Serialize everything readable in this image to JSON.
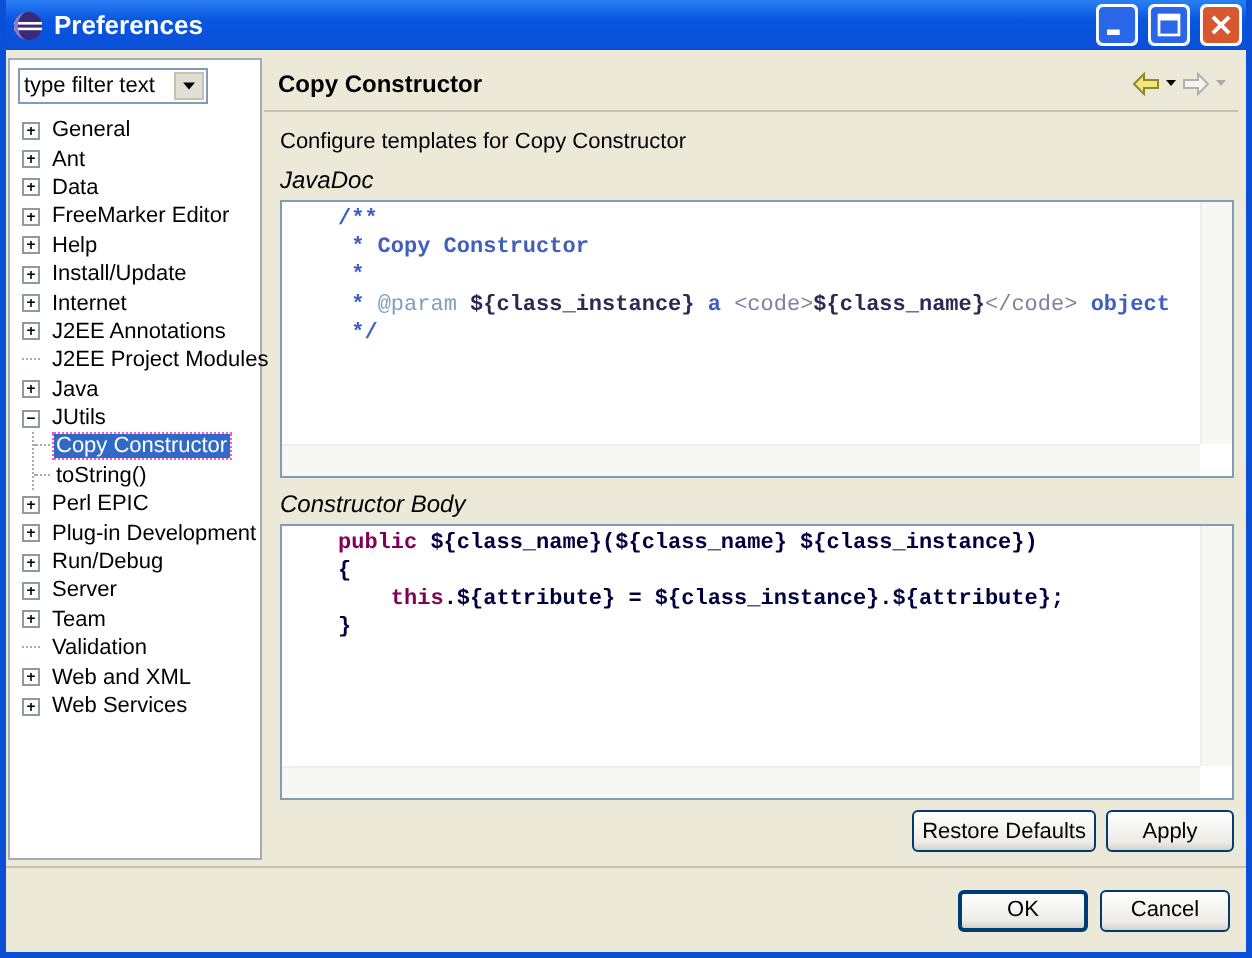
{
  "window": {
    "title": "Preferences"
  },
  "filter": {
    "placeholder": "type filter text"
  },
  "tree": [
    {
      "label": "General",
      "kind": "branch",
      "expanded": false,
      "selected": false
    },
    {
      "label": "Ant",
      "kind": "branch",
      "expanded": false,
      "selected": false
    },
    {
      "label": "Data",
      "kind": "branch",
      "expanded": false,
      "selected": false
    },
    {
      "label": "FreeMarker Editor",
      "kind": "branch",
      "expanded": false,
      "selected": false
    },
    {
      "label": "Help",
      "kind": "branch",
      "expanded": false,
      "selected": false
    },
    {
      "label": "Install/Update",
      "kind": "branch",
      "expanded": false,
      "selected": false
    },
    {
      "label": "Internet",
      "kind": "branch",
      "expanded": false,
      "selected": false
    },
    {
      "label": "J2EE Annotations",
      "kind": "branch",
      "expanded": false,
      "selected": false
    },
    {
      "label": "J2EE Project Modules",
      "kind": "leaf",
      "selected": false
    },
    {
      "label": "Java",
      "kind": "branch",
      "expanded": false,
      "selected": false
    },
    {
      "label": "JUtils",
      "kind": "branch",
      "expanded": true,
      "selected": false,
      "children": [
        {
          "label": "Copy Constructor",
          "kind": "leaf",
          "selected": true
        },
        {
          "label": "toString()",
          "kind": "leaf",
          "selected": false
        }
      ]
    },
    {
      "label": "Perl EPIC",
      "kind": "branch",
      "expanded": false,
      "selected": false
    },
    {
      "label": "Plug-in Development",
      "kind": "branch",
      "expanded": false,
      "selected": false
    },
    {
      "label": "Run/Debug",
      "kind": "branch",
      "expanded": false,
      "selected": false
    },
    {
      "label": "Server",
      "kind": "branch",
      "expanded": false,
      "selected": false
    },
    {
      "label": "Team",
      "kind": "branch",
      "expanded": false,
      "selected": false
    },
    {
      "label": "Validation",
      "kind": "leaf",
      "selected": false
    },
    {
      "label": "Web and XML",
      "kind": "branch",
      "expanded": false,
      "selected": false
    },
    {
      "label": "Web Services",
      "kind": "branch",
      "expanded": false,
      "selected": false
    }
  ],
  "page": {
    "title": "Copy Constructor",
    "description": "Configure templates for Copy Constructor"
  },
  "editors": [
    {
      "label": "JavaDoc",
      "lines": [
        [
          {
            "text": "/**",
            "kind": "comment"
          }
        ],
        [
          {
            "text": " * Copy Constructor",
            "kind": "comment"
          }
        ],
        [
          {
            "text": " *",
            "kind": "comment"
          }
        ],
        [
          {
            "text": " * ",
            "kind": "comment"
          },
          {
            "text": "@param",
            "kind": "tag"
          },
          {
            "text": " ${class_instance}",
            "kind": "variable"
          },
          {
            "text": " a ",
            "kind": "comment"
          },
          {
            "text": "<code>",
            "kind": "html"
          },
          {
            "text": "${class_name}",
            "kind": "variable"
          },
          {
            "text": "</code>",
            "kind": "html"
          },
          {
            "text": " object",
            "kind": "comment"
          }
        ],
        [
          {
            "text": " */",
            "kind": "comment"
          }
        ]
      ]
    },
    {
      "label": "Constructor Body",
      "lines": [
        [
          {
            "text": "public",
            "kind": "keyword"
          },
          {
            "text": " ${class_name}(${class_name} ${class_instance})",
            "kind": "plain"
          }
        ],
        [
          {
            "text": "{",
            "kind": "plain"
          }
        ],
        [
          {
            "text": "    this",
            "kind": "keyword"
          },
          {
            "text": ".${attribute} = ${class_instance}.${attribute};",
            "kind": "plain"
          }
        ],
        [
          {
            "text": "}",
            "kind": "plain"
          }
        ]
      ]
    }
  ],
  "page_buttons": [
    "Restore Defaults",
    "Apply"
  ],
  "dialog_buttons": [
    {
      "label": "OK",
      "default": true
    },
    {
      "label": "Cancel",
      "default": false
    }
  ]
}
